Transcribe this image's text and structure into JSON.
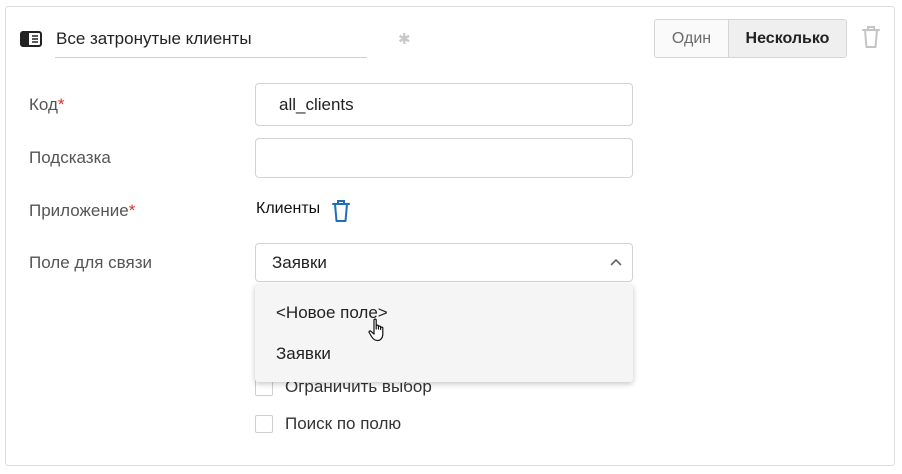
{
  "header": {
    "title_value": "Все затронутые клиенты",
    "mode_single": "Один",
    "mode_multiple": "Несколько",
    "asterisk_glyph": "✱"
  },
  "form": {
    "code_label": "Код",
    "code_value": "all_clients",
    "hint_label": "Подсказка",
    "hint_value": "",
    "app_label": "Приложение",
    "app_value": "Клиенты",
    "link_field_label": "Поле для связи",
    "link_field_value": "Заявки",
    "required_mark": "*"
  },
  "dropdown": {
    "options": [
      "<Новое поле>",
      "Заявки"
    ]
  },
  "checkboxes": [
    {
      "label": "Ограничить выбор",
      "checked": false
    },
    {
      "label": "Поиск по полю",
      "checked": false
    }
  ],
  "colors": {
    "required": "#e02d2d",
    "accent_blue": "#1f6fb5"
  }
}
